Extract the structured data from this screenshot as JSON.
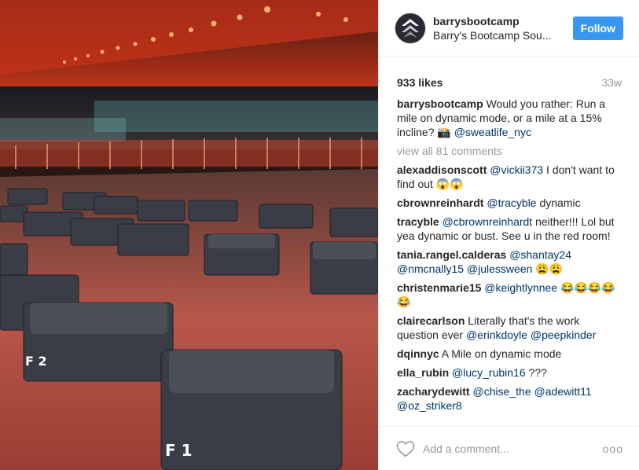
{
  "header": {
    "username": "barrysbootcamp",
    "location": "Barry's Bootcamp Sou...",
    "follow_label": "Follow"
  },
  "stats": {
    "likes": "933 likes",
    "age": "33w"
  },
  "caption": {
    "user": "barrysbootcamp",
    "text": "Would you rather: Run a mile on dynamic mode, or a mile at a 15% incline?",
    "emoji": "📸",
    "tag": "@sweatlife_nyc"
  },
  "view_all": "view all 81 comments",
  "comments": [
    {
      "user": "alexaddisonscott",
      "parts": [
        {
          "t": "tag",
          "v": "@vickii373"
        },
        {
          "t": "text",
          "v": " I don't want to find out 😱😱"
        }
      ]
    },
    {
      "user": "cbrownreinhardt",
      "parts": [
        {
          "t": "tag",
          "v": "@tracyble"
        },
        {
          "t": "text",
          "v": " dynamic"
        }
      ]
    },
    {
      "user": "tracyble",
      "parts": [
        {
          "t": "tag",
          "v": "@cbrownreinhardt"
        },
        {
          "t": "text",
          "v": " neither!!! Lol but yea dynamic or bust. See u in the red room!"
        }
      ]
    },
    {
      "user": "tania.rangel.calderas",
      "parts": [
        {
          "t": "tag",
          "v": "@shantay24"
        },
        {
          "t": "text",
          "v": " "
        },
        {
          "t": "tag",
          "v": "@nmcnally15"
        },
        {
          "t": "text",
          "v": " "
        },
        {
          "t": "tag",
          "v": "@julessween"
        },
        {
          "t": "text",
          "v": " 😩😩"
        }
      ]
    },
    {
      "user": "christenmarie15",
      "parts": [
        {
          "t": "tag",
          "v": "@keightlynnee"
        },
        {
          "t": "text",
          "v": " 😂😂😂😂😂"
        }
      ]
    },
    {
      "user": "clairecarlson",
      "parts": [
        {
          "t": "text",
          "v": "Literally that's the work question ever "
        },
        {
          "t": "tag",
          "v": "@erinkdoyle"
        },
        {
          "t": "text",
          "v": " "
        },
        {
          "t": "tag",
          "v": "@peepkinder"
        }
      ]
    },
    {
      "user": "dqinnyc",
      "parts": [
        {
          "t": "text",
          "v": "A Mile on dynamic mode"
        }
      ]
    },
    {
      "user": "ella_rubin",
      "parts": [
        {
          "t": "tag",
          "v": "@lucy_rubin16"
        },
        {
          "t": "text",
          "v": " ???"
        }
      ]
    },
    {
      "user": "zacharydewitt",
      "parts": [
        {
          "t": "tag",
          "v": "@chise_the"
        },
        {
          "t": "text",
          "v": " "
        },
        {
          "t": "tag",
          "v": "@adewitt11"
        },
        {
          "t": "text",
          "v": " "
        },
        {
          "t": "tag",
          "v": "@oz_striker8"
        }
      ]
    }
  ],
  "footer": {
    "placeholder": "Add a comment...",
    "more": "ooo"
  },
  "photo": {
    "step_labels": [
      "F 2",
      "F 1"
    ]
  },
  "colors": {
    "accent": "#3897f0",
    "tag": "#003569",
    "muted": "#999999"
  },
  "icons": {
    "like": "heart-outline-icon",
    "more": "more-options-icon",
    "avatar_logo": "barrys-logo-icon"
  }
}
